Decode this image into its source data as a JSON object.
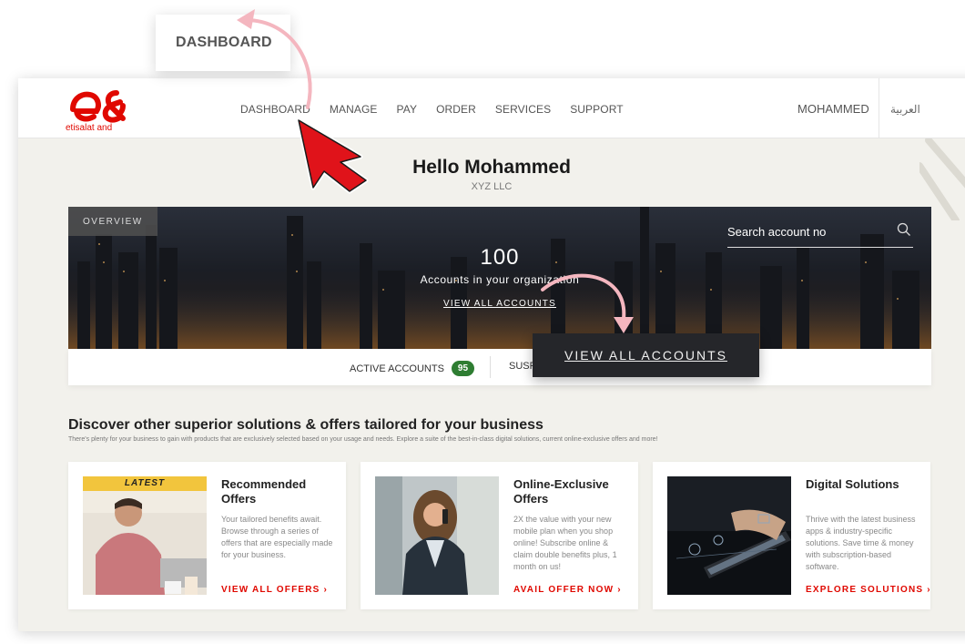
{
  "callout_top": {
    "label": "DASHBOARD"
  },
  "header": {
    "logo_text": "etisalat and",
    "nav": [
      "DASHBOARD",
      "MANAGE",
      "PAY",
      "ORDER",
      "SERVICES",
      "SUPPORT"
    ],
    "user": "MOHAMMED",
    "lang": "العربية"
  },
  "greeting": {
    "title": "Hello Mohammed",
    "company": "XYZ LLC"
  },
  "hero": {
    "tag": "OVERVIEW",
    "count": "100",
    "subtitle": "Accounts in your organization",
    "link": "VIEW ALL ACCOUNTS",
    "search_placeholder": "Search account no"
  },
  "status": {
    "active_label": "ACTIVE ACCOUNTS",
    "active_count": "95",
    "suspended_label": "SUSP"
  },
  "zoom_popup": {
    "label": "VIEW ALL ACCOUNTS"
  },
  "discover": {
    "title": "Discover other superior solutions & offers tailored for your business",
    "subtitle": "There's plenty for your business to gain with products that are exclusively selected based on your usage and needs. Explore a suite of the best-in-class digital solutions, current online-exclusive offers and more!"
  },
  "cards": [
    {
      "tag": "LATEST",
      "title": "Recommended Offers",
      "desc": "Your tailored benefits await. Browse through a series of offers that are especially made for your business.",
      "cta": "VIEW ALL OFFERS  ›"
    },
    {
      "title": "Online-Exclusive Offers",
      "desc": "2X the value with your new mobile plan when you shop online! Subscribe online & claim double benefits plus, 1 month on us!",
      "cta": "AVAIL OFFER NOW  ›"
    },
    {
      "title": "Digital Solutions",
      "desc": "Thrive with the latest business apps & industry-specific solutions. Save time & money with subscription-based software.",
      "cta": "EXPLORE SOLUTIONS  ›"
    }
  ],
  "colors": {
    "brand_red": "#e00800",
    "badge_green": "#2e7d32",
    "latest_yellow": "#f2c53d",
    "pink_arrow": "#f4b6bf"
  }
}
